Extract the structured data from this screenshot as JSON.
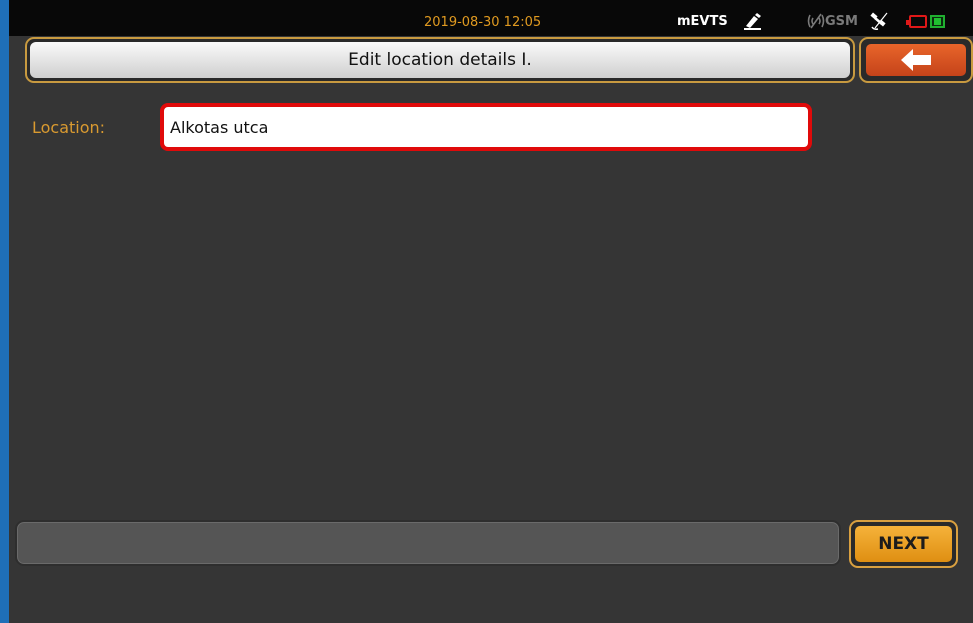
{
  "status_bar": {
    "datetime": "2019-08-30 12:05",
    "app_name": "mEVTS",
    "network_label": "GSM",
    "icons": [
      "pen-edit-icon",
      "gsm-signal-off-icon",
      "satellite-icon",
      "battery-low-icon",
      "battery-charged-icon"
    ],
    "colors": {
      "datetime": "#e09a20",
      "battery_low": "#e01818",
      "battery_ok": "#20b030"
    }
  },
  "header": {
    "title": "Edit location details I.",
    "back_icon": "arrow-left-icon"
  },
  "form": {
    "location_label": "Location:",
    "location_value": "Alkotas utca"
  },
  "footer": {
    "message": "",
    "next_label": "NEXT"
  },
  "colors": {
    "accent": "#e0902a",
    "back_button": "#d9552a",
    "focus_border": "#e00a0a",
    "background": "#353535"
  }
}
